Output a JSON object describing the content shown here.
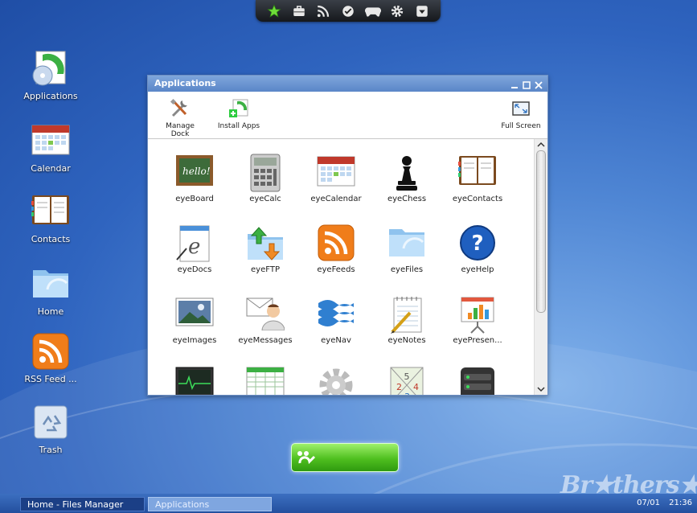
{
  "desktop": {
    "icons": [
      {
        "label": "Applications"
      },
      {
        "label": "Calendar"
      },
      {
        "label": "Contacts"
      },
      {
        "label": "Home"
      },
      {
        "label": "RSS Feed ..."
      },
      {
        "label": "Trash"
      }
    ]
  },
  "window": {
    "title": "Applications",
    "toolbar": {
      "manage_dock": "Manage Dock",
      "install_apps": "Install Apps",
      "full_screen": "Full Screen"
    },
    "apps": [
      {
        "label": "eyeBoard"
      },
      {
        "label": "eyeCalc"
      },
      {
        "label": "eyeCalendar"
      },
      {
        "label": "eyeChess"
      },
      {
        "label": "eyeContacts"
      },
      {
        "label": "eyeDocs"
      },
      {
        "label": "eyeFTP"
      },
      {
        "label": "eyeFeeds"
      },
      {
        "label": "eyeFiles"
      },
      {
        "label": "eyeHelp"
      },
      {
        "label": "eyeImages"
      },
      {
        "label": "eyeMessages"
      },
      {
        "label": "eyeNav"
      },
      {
        "label": "eyeNotes"
      },
      {
        "label": "eyePresen..."
      },
      {
        "label": ""
      },
      {
        "label": ""
      },
      {
        "label": ""
      },
      {
        "label": ""
      },
      {
        "label": ""
      }
    ]
  },
  "taskbar": {
    "tasks": [
      {
        "label": "Home - Files Manager"
      },
      {
        "label": "Applications"
      }
    ],
    "date": "07/01",
    "time": "21:36"
  },
  "watermark": "Br★thers★ft",
  "colors": {
    "accent": "#5a86c8",
    "launcher": "#4fbf1f",
    "desktop": "#2f64bf"
  }
}
